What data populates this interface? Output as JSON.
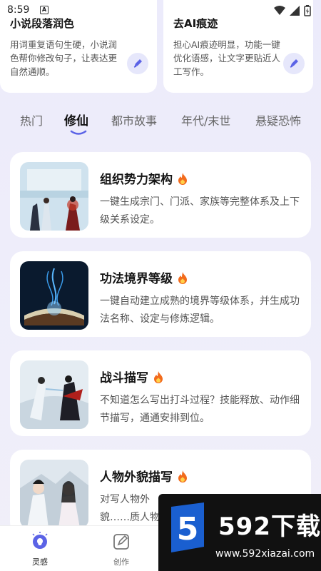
{
  "status": {
    "time": "8:59"
  },
  "top_cards": [
    {
      "title": "小说段落润色",
      "desc": "用词重复语句生硬，小说润色帮你修改句子，让表达更自然通顺。"
    },
    {
      "title": "去AI痕迹",
      "desc": "担心AI痕迹明显，功能一键优化语感，让文字更贴近人工写作。"
    }
  ],
  "tabs": [
    "热门",
    "修仙",
    "都市故事",
    "年代/末世",
    "悬疑恐怖"
  ],
  "active_tab": "修仙",
  "cards": [
    {
      "title": "组织势力架构",
      "desc": "一键生成宗门、门派、家族等完整体系及上下级关系设定。"
    },
    {
      "title": "功法境界等级",
      "desc": "一键自动建立成熟的境界等级体系，并生成功法名称、设定与修炼逻辑。"
    },
    {
      "title": "战斗描写",
      "desc": "不知道怎么写出打斗过程？技能释放、动作细节描写，通通安排到位。"
    },
    {
      "title": "人物外貌描写",
      "desc": "对写人物外貌……质人物外貌……"
    }
  ],
  "bottom_nav": [
    {
      "label": "灵感",
      "icon": "lightbulb-icon"
    },
    {
      "label": "创作",
      "icon": "edit-icon"
    }
  ],
  "watermark": {
    "title": "592下载",
    "url": "www.592xiazai.com",
    "mark": "5"
  },
  "colors": {
    "accent": "#5b63e6",
    "fire": "#f26b1d",
    "background": "#eeedfa"
  }
}
